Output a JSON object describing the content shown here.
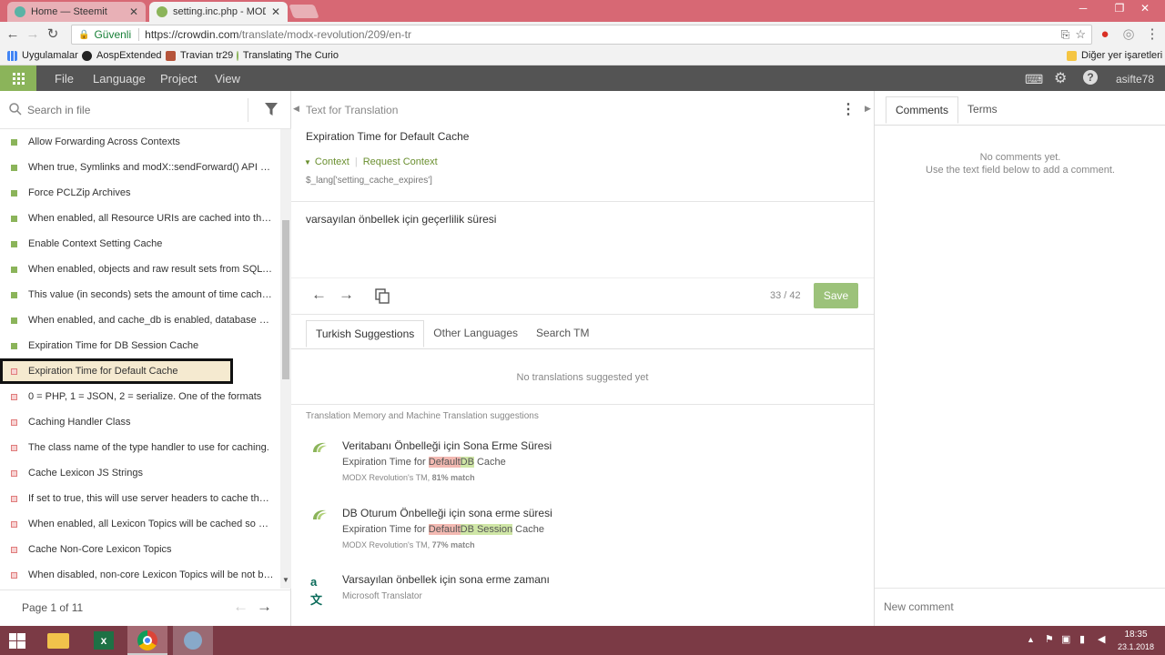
{
  "browser": {
    "tabs": [
      {
        "label": "Home — Steemit",
        "active": false
      },
      {
        "label": "setting.inc.php - MODX",
        "active": true
      }
    ],
    "address": {
      "secure_label": "Güvenli",
      "url_host": "https://crowdin.com",
      "url_path": "/translate/modx-revolution/209/en-tr"
    },
    "bookmarks": [
      "Uygulamalar",
      "AospExtended",
      "Travian tr29",
      "Translating The Curio"
    ],
    "other_bookmarks": "Diğer yer işaretleri"
  },
  "appbar": {
    "menu": [
      "File",
      "Language",
      "Project",
      "View"
    ],
    "username": "asifte78"
  },
  "left": {
    "search_placeholder": "Search in file",
    "items": [
      {
        "text": "Allow Forwarding Across Contexts",
        "status": "done"
      },
      {
        "text": "When true, Symlinks and modX::sendForward() API calls can forward requests to Resources in other Contexts.",
        "status": "done"
      },
      {
        "text": "Force PCLZip Archives",
        "status": "done"
      },
      {
        "text": "When enabled, all Resource URIs are cached into the Context.",
        "status": "done"
      },
      {
        "text": "Enable Context Setting Cache",
        "status": "done"
      },
      {
        "text": "When enabled, objects and raw result sets from SQL queries are cached.",
        "status": "done"
      },
      {
        "text": "This value (in seconds) sets the amount of time cache files last.",
        "status": "done"
      },
      {
        "text": "When enabled, and cache_db is enabled, database sessions are cached.",
        "status": "done"
      },
      {
        "text": "Expiration Time for DB Session Cache",
        "status": "done"
      },
      {
        "text": "Expiration Time for Default Cache",
        "status": "untranslated",
        "selected": true
      },
      {
        "text": "0 = PHP, 1 = JSON, 2 = serialize. One of the formats",
        "status": "untranslated"
      },
      {
        "text": "Caching Handler Class",
        "status": "untranslated"
      },
      {
        "text": "The class name of the type handler to use for caching.",
        "status": "untranslated"
      },
      {
        "text": "Cache Lexicon JS Strings",
        "status": "untranslated"
      },
      {
        "text": "If set to true, this will use server headers to cache the lexicon strings loaded into JavaScript.",
        "status": "untranslated"
      },
      {
        "text": "When enabled, all Lexicon Topics will be cached so as to reduce load time.",
        "status": "untranslated"
      },
      {
        "text": "Cache Non-Core Lexicon Topics",
        "status": "untranslated"
      },
      {
        "text": "When disabled, non-core Lexicon Topics will be not be cached.",
        "status": "untranslated"
      }
    ],
    "pager": "Page 1 of 11"
  },
  "center": {
    "header_label": "Text for Translation",
    "source_text": "Expiration Time for Default Cache",
    "context_label": "Context",
    "request_context_label": "Request Context",
    "key": "$_lang['setting_cache_expires']",
    "translation": "varsayılan önbellek için geçerlilik süresi",
    "counter": "33 / 42",
    "save_label": "Save",
    "tabs": [
      "Turkish Suggestions",
      "Other Languages",
      "Search TM"
    ],
    "no_suggestions": "No translations suggested yet",
    "tm_header": "Translation Memory and Machine Translation suggestions",
    "suggestions": [
      {
        "title": "Veritabanı Önbelleği için Sona Erme Süresi",
        "src_pre": "Expiration Time for ",
        "src_red": "Default",
        "src_green": "DB",
        "src_mid": "",
        "src_green2": "",
        "src_post": " Cache",
        "origin": "MODX Revolution's TM, ",
        "match": "81% match"
      },
      {
        "title": "DB Oturum Önbelleği için sona erme süresi",
        "src_pre": "Expiration Time for ",
        "src_red": "Default",
        "src_green": "DB",
        "src_mid": " ",
        "src_green2": "Session",
        "src_post": " Cache",
        "origin": "MODX Revolution's TM, ",
        "match": "77% match"
      },
      {
        "title": "Varsayılan önbellek için sona erme zamanı",
        "origin": "Microsoft Translator"
      }
    ]
  },
  "right": {
    "tabs": [
      "Comments",
      "Terms"
    ],
    "empty_line1": "No comments yet.",
    "empty_line2": "Use the text field below to add a comment.",
    "new_comment_placeholder": "New comment"
  },
  "taskbar": {
    "time": "18:35",
    "date": "23.1.2018"
  },
  "colors": {
    "done": "#8bb45a",
    "untranslated": "#e07c7c",
    "selected_bg": "#f5ead0",
    "accent_green": "#6a8f2f",
    "save_bg": "#9cc27a"
  }
}
